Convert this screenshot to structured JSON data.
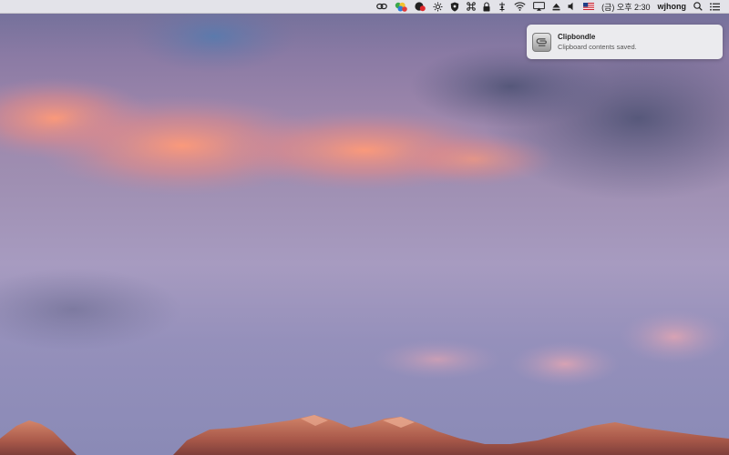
{
  "menubar": {
    "items": [
      {
        "icon": "link-icon"
      },
      {
        "icon": "colorful-app-icon"
      },
      {
        "icon": "red-badge-app-icon"
      },
      {
        "icon": "brightness-icon"
      },
      {
        "icon": "shield-icon"
      },
      {
        "icon": "command-icon"
      },
      {
        "icon": "lock-icon"
      },
      {
        "icon": "network-icon"
      },
      {
        "icon": "wifi-icon"
      },
      {
        "icon": "airplay-icon"
      },
      {
        "icon": "eject-icon"
      },
      {
        "icon": "volume-icon"
      },
      {
        "icon": "us-flag-icon"
      }
    ],
    "clock": "(금) 오후 2:30",
    "user": "wjhong",
    "search_icon": "search-icon",
    "notification_center_icon": "list-icon"
  },
  "notification": {
    "app_icon": "clipbondle-icon",
    "title": "Clipbondle",
    "body": "Clipboard contents saved."
  },
  "wallpaper": {
    "description_colors": {
      "sky_top": "#6e6e98",
      "cloud_pink": "#f0907a",
      "sky_lower": "#a79bc0",
      "mountain": "#b3604a"
    }
  }
}
